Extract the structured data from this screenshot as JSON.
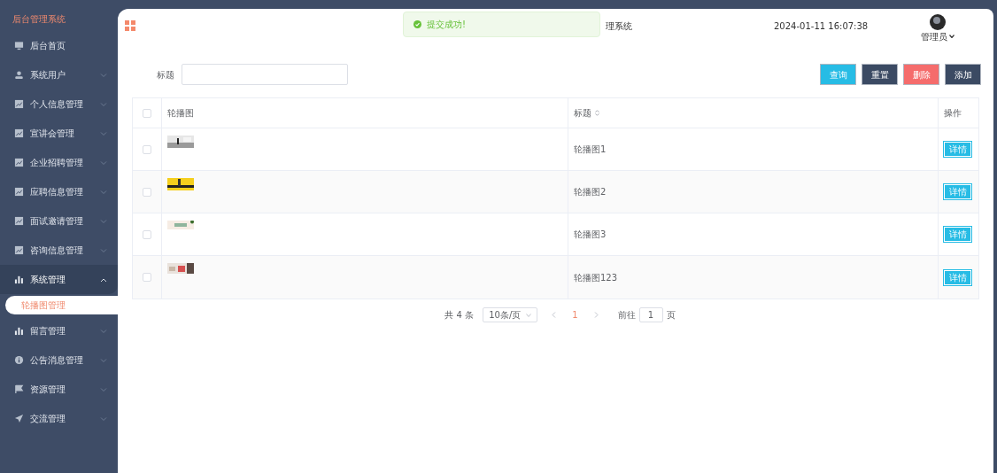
{
  "sidebar": {
    "title": "后台管理系统",
    "items": [
      {
        "label": "后台首页",
        "expandable": false,
        "expanded": false
      },
      {
        "label": "系统用户",
        "expandable": true,
        "expanded": false
      },
      {
        "label": "个人信息管理",
        "expandable": true,
        "expanded": false
      },
      {
        "label": "宣讲会管理",
        "expandable": true,
        "expanded": false
      },
      {
        "label": "企业招聘管理",
        "expandable": true,
        "expanded": false
      },
      {
        "label": "应聘信息管理",
        "expandable": true,
        "expanded": false
      },
      {
        "label": "面试邀请管理",
        "expandable": true,
        "expanded": false
      },
      {
        "label": "咨询信息管理",
        "expandable": true,
        "expanded": false
      },
      {
        "label": "系统管理",
        "expandable": true,
        "expanded": true,
        "children": [
          {
            "label": "轮播图管理",
            "selected": true
          }
        ]
      },
      {
        "label": "留言管理",
        "expandable": true,
        "expanded": false
      },
      {
        "label": "公告消息管理",
        "expandable": true,
        "expanded": false
      },
      {
        "label": "资源管理",
        "expandable": true,
        "expanded": false
      },
      {
        "label": "交流管理",
        "expandable": true,
        "expanded": false
      }
    ]
  },
  "header": {
    "title": "理系统",
    "datetime": "2024-01-11 16:07:38",
    "user": "管理员"
  },
  "toast": {
    "message": "提交成功!"
  },
  "search": {
    "label": "标题"
  },
  "buttons": [
    {
      "label": "查询",
      "kind": "primary"
    },
    {
      "label": "重置",
      "kind": "dark"
    },
    {
      "label": "删除",
      "kind": "danger"
    },
    {
      "label": "添加",
      "kind": "dark"
    }
  ],
  "table": {
    "all_checked": false,
    "columns": [
      {
        "label": "轮播图",
        "sortable": false
      },
      {
        "label": "标题",
        "sortable": true
      },
      {
        "label": "操作",
        "sortable": false
      }
    ],
    "rows": [
      {
        "checked": false,
        "title": "轮播图1",
        "action": "详情"
      },
      {
        "checked": false,
        "title": "轮播图2",
        "action": "详情"
      },
      {
        "checked": false,
        "title": "轮播图3",
        "action": "详情"
      },
      {
        "checked": false,
        "title": "轮播图123",
        "action": "详情"
      }
    ]
  },
  "pagination": {
    "total": "共 4 条",
    "page_size": "10条/页",
    "pages": [
      {
        "label": "1",
        "selected": true
      }
    ],
    "goto_label": "前往",
    "goto_value": "1",
    "goto_suffix": "页"
  }
}
